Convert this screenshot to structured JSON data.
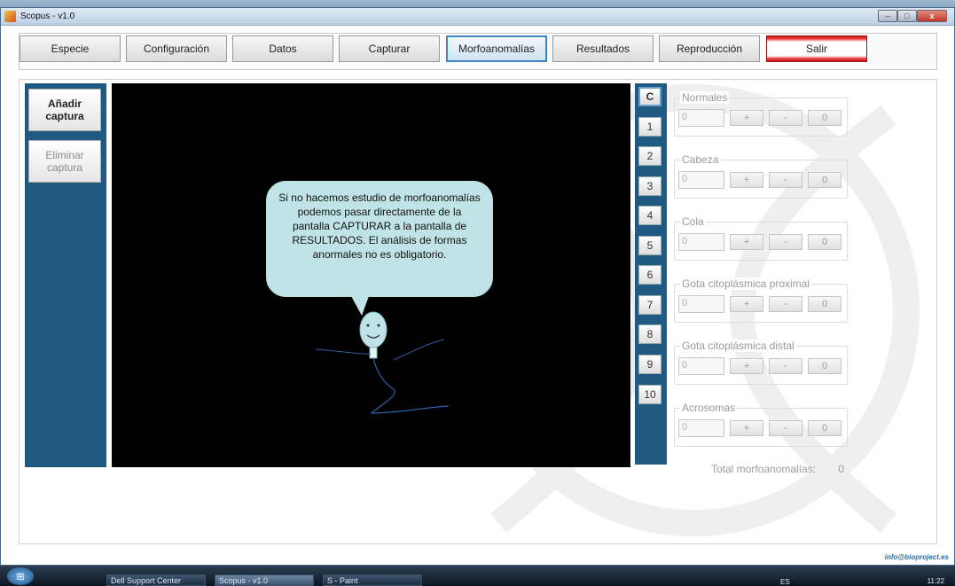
{
  "window": {
    "title": "Scopus - v1.0",
    "controls": {
      "minimize": "–",
      "maximize": "□",
      "close": "x"
    }
  },
  "nav": {
    "items": [
      {
        "label": "Especie"
      },
      {
        "label": "Configuración"
      },
      {
        "label": "Datos"
      },
      {
        "label": "Capturar"
      },
      {
        "label": "Morfoanomalías"
      },
      {
        "label": "Resultados"
      },
      {
        "label": "Reproducción"
      },
      {
        "label": "Salir"
      }
    ]
  },
  "sidebar": {
    "add_capture": "Añadir captura",
    "remove_capture": "Eliminar captura"
  },
  "viewer": {
    "tip_text": "Si no hacemos estudio de morfoanomalías podemos pasar directamente de la pantalla CAPTURAR  a la pantalla de RESULTADOS. El análisis de formas anormales no es obligatorio."
  },
  "capture_numbers": [
    "C",
    "1",
    "2",
    "3",
    "4",
    "5",
    "6",
    "7",
    "8",
    "9",
    "10"
  ],
  "groups": [
    {
      "title": "Normales",
      "value": "0",
      "plus": "+",
      "minus": "-",
      "reset": "0"
    },
    {
      "title": "Cabeza",
      "value": "0",
      "plus": "+",
      "minus": "-",
      "reset": "0"
    },
    {
      "title": "Cola",
      "value": "0",
      "plus": "+",
      "minus": "-",
      "reset": "0"
    },
    {
      "title": "Gota citoplásmica proximal",
      "value": "0",
      "plus": "+",
      "minus": "-",
      "reset": "0"
    },
    {
      "title": "Gota citoplásmica distal",
      "value": "0",
      "plus": "+",
      "minus": "-",
      "reset": "0"
    },
    {
      "title": "Acrosomas",
      "value": "0",
      "plus": "+",
      "minus": "-",
      "reset": "0"
    }
  ],
  "total": {
    "label": "Total morfoanomalías:",
    "value": "0"
  },
  "footer": {
    "email": "info@bioproject.es"
  },
  "taskbar": {
    "tasks": [
      "Dell Support Center",
      "Scopus - v1.0",
      "S - Paint"
    ],
    "lang": "ES",
    "clock": "11:22"
  },
  "colors": {
    "sidebar": "#1f5a82",
    "active_tab_border": "#3f86c4",
    "tip_bubble": "#bfe3e6",
    "salir_stripe": "#e02020"
  }
}
